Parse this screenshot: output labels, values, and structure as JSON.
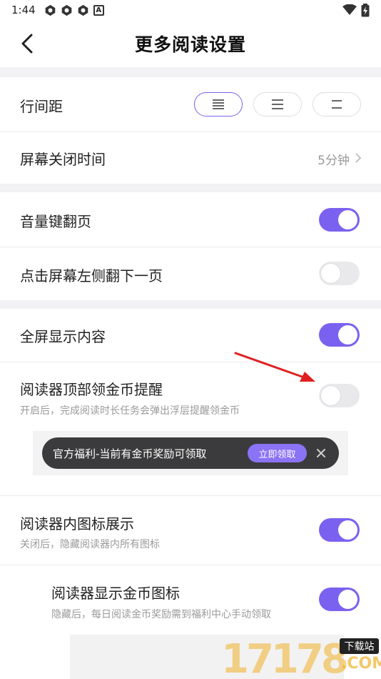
{
  "status_bar": {
    "time": "1:44",
    "badge": "A"
  },
  "header": {
    "title": "更多阅读设置"
  },
  "line_spacing": {
    "label": "行间距",
    "options": [
      "≡",
      "☰",
      "☰"
    ],
    "selected_index": 0
  },
  "screen_off": {
    "label": "屏幕关闭时间",
    "value": "5分钟"
  },
  "volume_page": {
    "label": "音量键翻页",
    "on": true
  },
  "tap_left": {
    "label": "点击屏幕左侧翻下一页",
    "on": false
  },
  "fullscreen": {
    "label": "全屏显示内容",
    "on": true
  },
  "coin_reminder": {
    "label": "阅读器顶部领金币提醒",
    "sub": "开启后，完成阅读时长任务会弹出浮层提醒领金币",
    "on": false
  },
  "toast": {
    "text": "官方福利-当前有金币奖励可领取",
    "button": "立即领取"
  },
  "icons_display": {
    "label": "阅读器内图标展示",
    "sub": "关闭后，隐藏阅读器内所有图标",
    "on": true
  },
  "coin_icon": {
    "label": "阅读器显示金币图标",
    "sub": "隐藏后，每日阅读金币奖励需到福利中心手动领取",
    "on": true
  },
  "watermark": {
    "brand": "17178",
    "tag": "下载站",
    "suffix": ".COM"
  },
  "colors": {
    "accent": "#7b61f0",
    "arrow": "#e02020"
  }
}
